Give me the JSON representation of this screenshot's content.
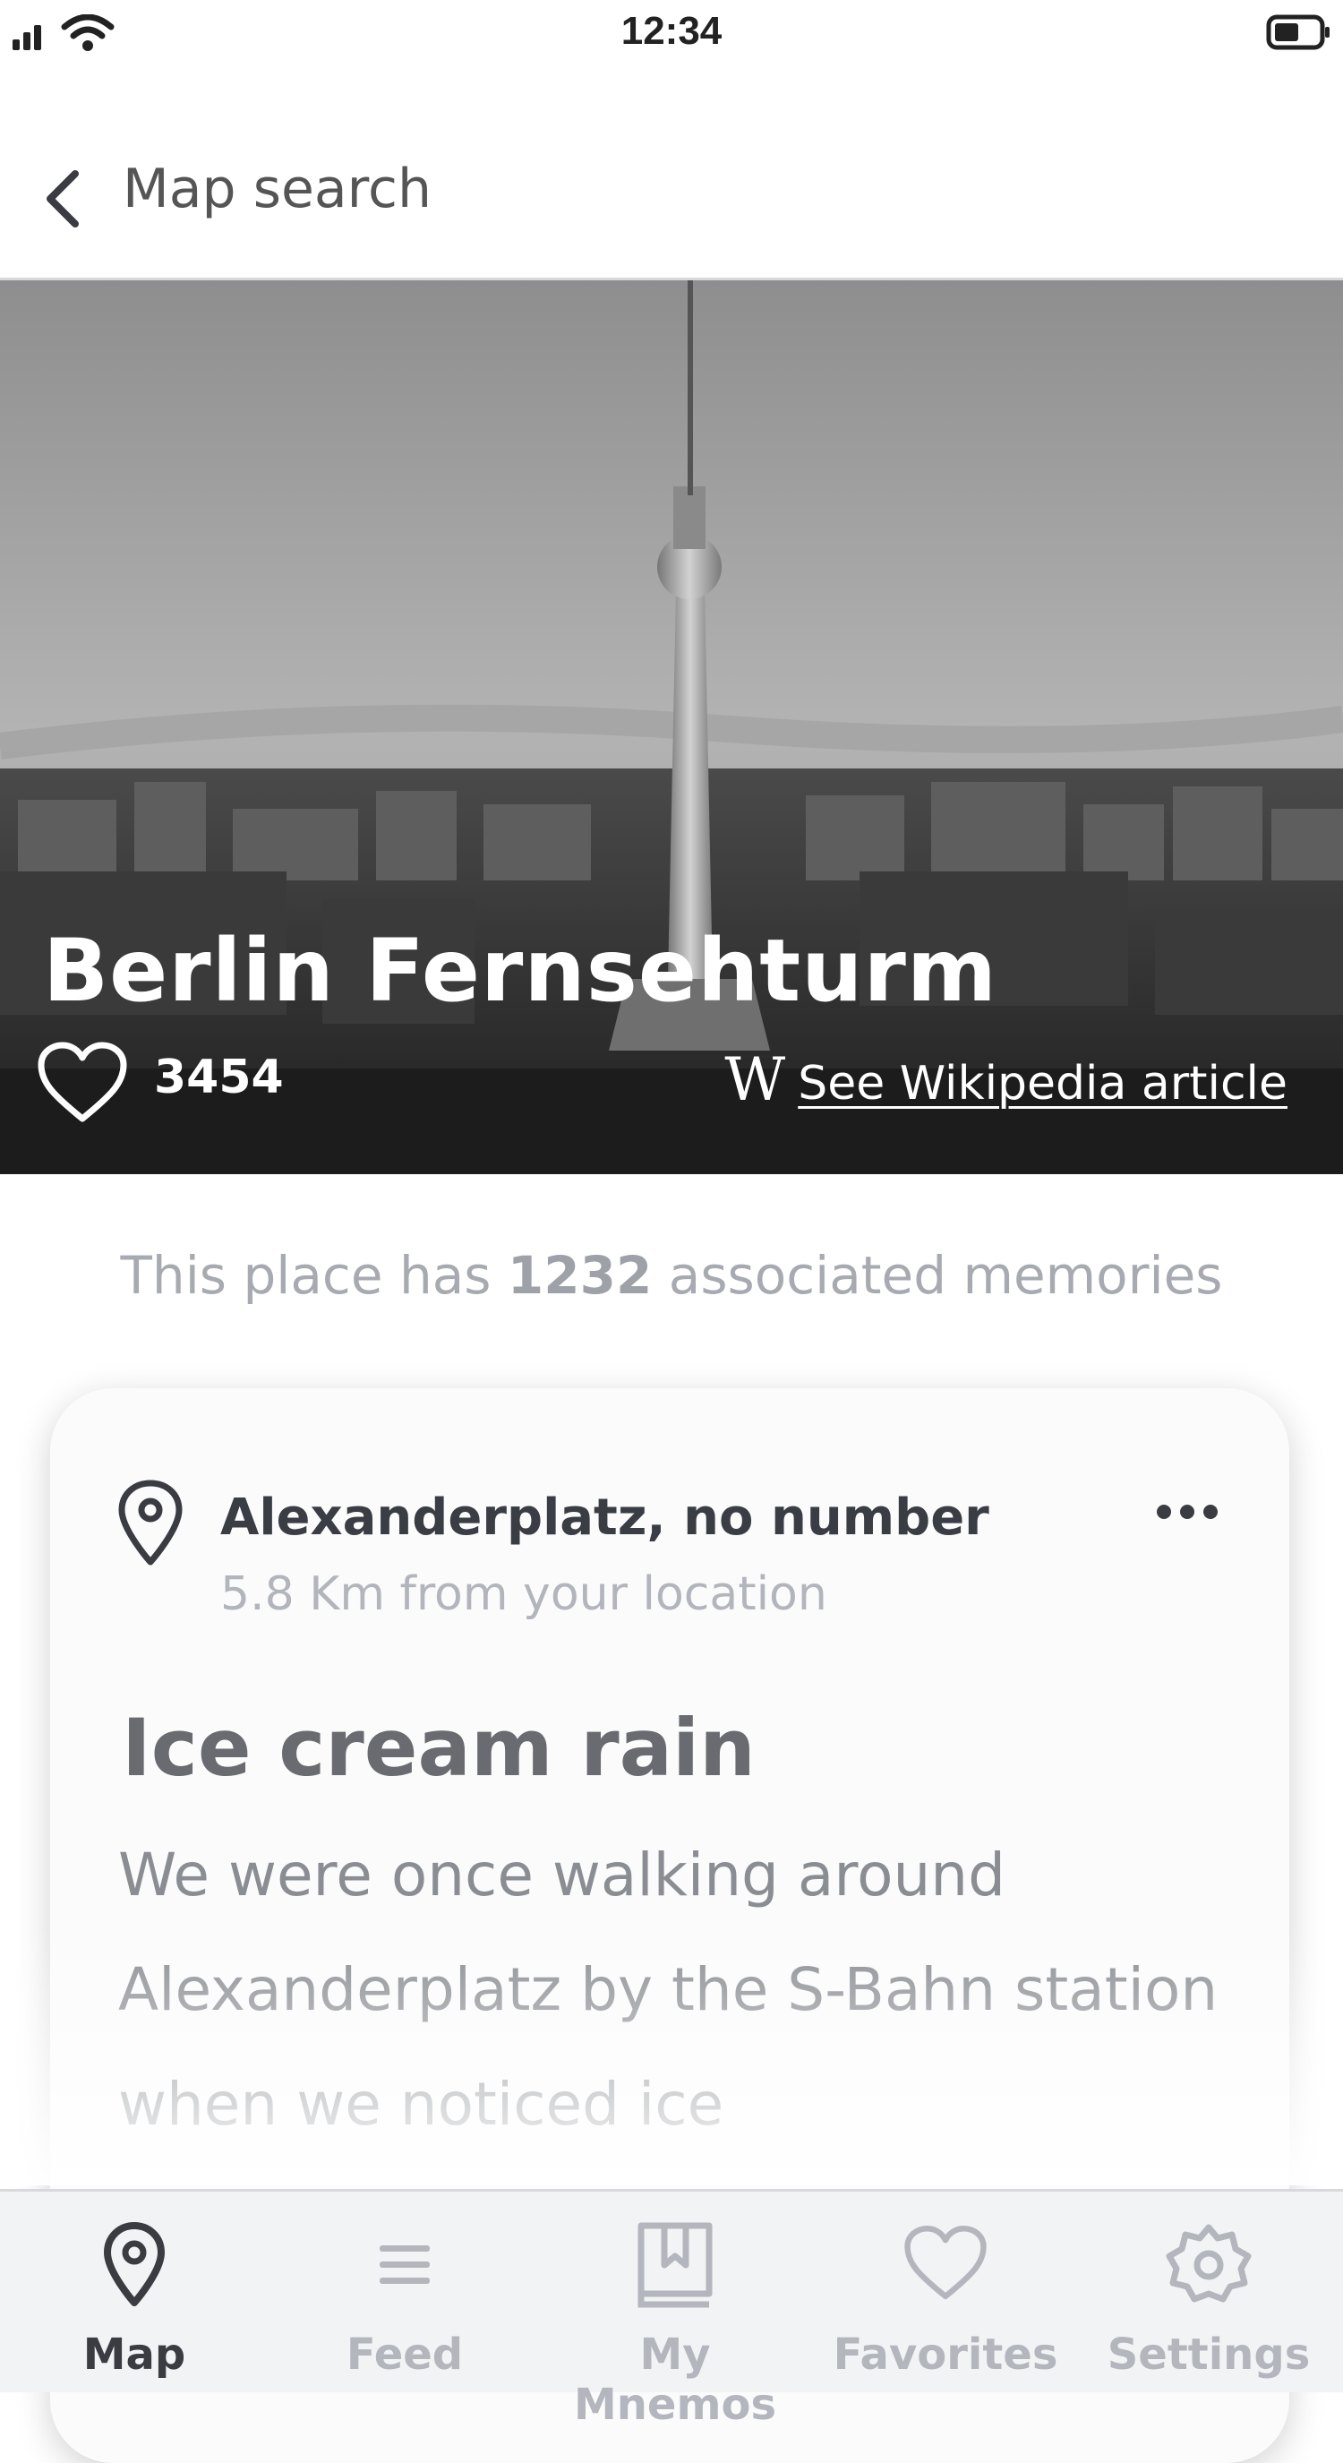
{
  "status_bar": {
    "time": "12:34"
  },
  "nav": {
    "back_label": "Map search"
  },
  "place": {
    "name": "Berlin Fernsehturm",
    "likes": "3454",
    "wiki_logo": "W",
    "wiki_link": "See Wikipedia article"
  },
  "memories": {
    "prefix": "This place has ",
    "count": "1232",
    "suffix": " associated memories"
  },
  "card": {
    "address": "Alexanderplatz, no number",
    "distance": "5.8 Km from your location",
    "title": "Ice cream rain",
    "body": "We were once walking around Alexanderplatz by the S-Bahn station when we noticed ice"
  },
  "tabs": [
    {
      "label": "Map",
      "icon": "map-pin-icon",
      "active": true
    },
    {
      "label": "Feed",
      "icon": "menu-icon",
      "active": false
    },
    {
      "label": "My Mnemos",
      "icon": "book-icon",
      "active": false
    },
    {
      "label": "Favorites",
      "icon": "heart-icon",
      "active": false
    },
    {
      "label": "Settings",
      "icon": "gear-icon",
      "active": false
    }
  ],
  "colors": {
    "active_tab": "#3a3c42",
    "inactive_tab": "#b3b6bd",
    "muted_text": "#a7aab1"
  }
}
